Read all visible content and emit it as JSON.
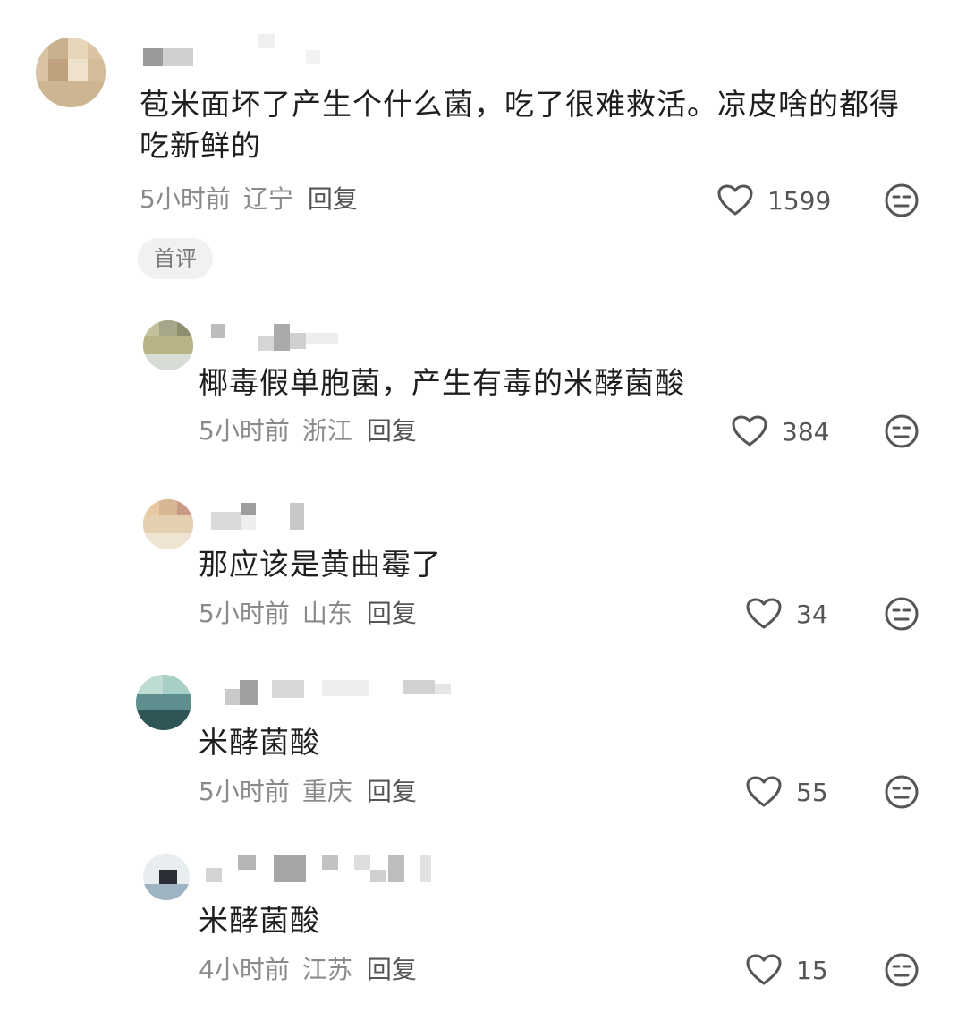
{
  "comments": [
    {
      "text": "苞米面坏了产生个什么菌，吃了很难救活。凉皮啥的都得吃新鲜的",
      "time": "5小时前",
      "location": "辽宁",
      "reply_label": "回复",
      "likes": "1599",
      "badge": "首评"
    },
    {
      "text": "椰毒假单胞菌，产生有毒的米酵菌酸",
      "time": "5小时前",
      "location": "浙江",
      "reply_label": "回复",
      "likes": "384"
    },
    {
      "text": "那应该是黄曲霉了",
      "time": "5小时前",
      "location": "山东",
      "reply_label": "回复",
      "likes": "34"
    },
    {
      "text": "米酵菌酸",
      "time": "5小时前",
      "location": "重庆",
      "reply_label": "回复",
      "likes": "55"
    },
    {
      "text": "米酵菌酸",
      "time": "4小时前",
      "location": "江苏",
      "reply_label": "回复",
      "likes": "15"
    }
  ],
  "icons": {
    "like": "heart-outline-icon",
    "dislike": "meh-face-icon"
  },
  "colors": {
    "text": "#1f1f1f",
    "meta": "#8a8a8a",
    "icon": "#555555"
  }
}
